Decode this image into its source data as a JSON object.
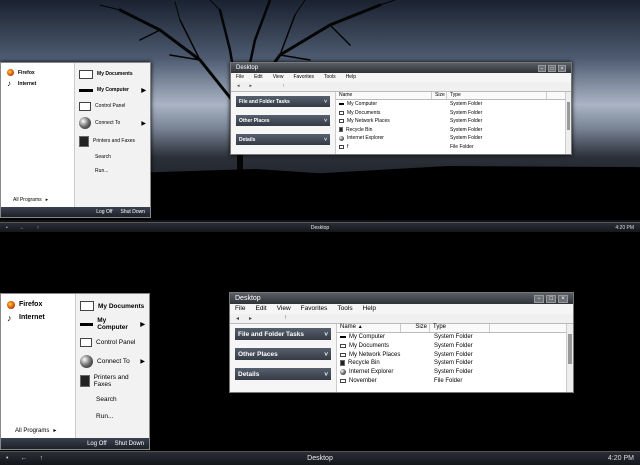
{
  "taskbar": {
    "start_symbol": "•",
    "back": "←",
    "forward": "→",
    "pin": "↑",
    "task_label": "Desktop",
    "clock": "4:20 PM"
  },
  "start_menu": {
    "pinned": [
      {
        "label": "Firefox",
        "icon": "firefox-icon"
      },
      {
        "label": "Internet",
        "icon": "internet-icon"
      }
    ],
    "right_items": [
      {
        "label": "My Documents",
        "icon": "folder-icon",
        "bold": true
      },
      {
        "label": "My Computer",
        "icon": "computer-icon",
        "bold": true,
        "arrow": "▶"
      },
      {
        "label": "Control Panel",
        "icon": "control-panel-icon"
      },
      {
        "label": "Connect To",
        "icon": "globe-icon",
        "arrow": "▶"
      },
      {
        "label": "Printers and Faxes",
        "icon": "printer-icon"
      },
      {
        "label": "Search",
        "icon": ""
      },
      {
        "label": "Run...",
        "icon": ""
      }
    ],
    "all_programs": "All Programs",
    "all_programs_arrow": "▸",
    "log_off": "Log Off",
    "shut_down": "Shut Down"
  },
  "explorer": {
    "title": "Desktop",
    "controls": {
      "minimize": "−",
      "maximize": "□",
      "close": "×"
    },
    "menu": [
      "File",
      "Edit",
      "View",
      "Favorites",
      "Tools",
      "Help"
    ],
    "toolbar": {
      "back": "◂",
      "forward": "▸",
      "up": "↑"
    },
    "task_panels": [
      {
        "label": "File and Folder Tasks",
        "chevron": "˅"
      },
      {
        "label": "Other Places",
        "chevron": "˅"
      },
      {
        "label": "Details",
        "chevron": "˅"
      }
    ],
    "columns": {
      "name": "Name",
      "sort": "▲",
      "size": "Size",
      "type": "Type"
    },
    "rows": [
      {
        "name": "My Computer",
        "type": "System Folder",
        "icon": "computer-icon"
      },
      {
        "name": "My Documents",
        "type": "System Folder",
        "icon": "folder-icon"
      },
      {
        "name": "My Network Places",
        "type": "System Folder",
        "icon": "network-icon"
      },
      {
        "name": "Recycle Bin",
        "type": "System Folder",
        "icon": "recycle-bin-icon"
      },
      {
        "name": "Internet Explorer",
        "type": "System Folder",
        "icon": "internet-explorer-icon"
      }
    ],
    "row_last_top": {
      "name": "f",
      "type": "File Folder",
      "icon": "folder-icon"
    },
    "row_last_bottom": {
      "name": "November",
      "type": "File Folder",
      "icon": "folder-icon"
    }
  }
}
